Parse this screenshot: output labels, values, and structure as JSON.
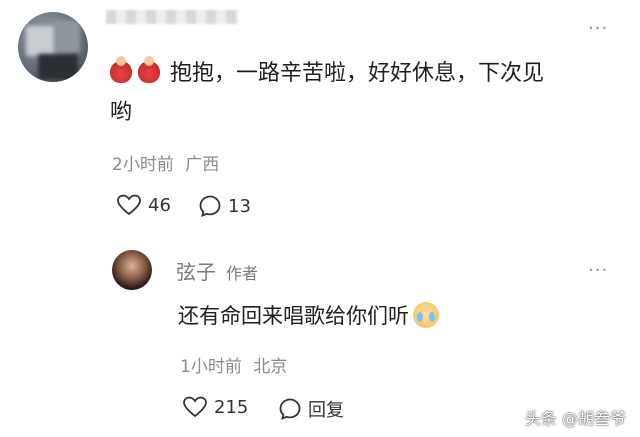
{
  "comment": {
    "text_line1": "抱抱，一路辛苦啦，好好休息，下次见",
    "text_line2": "哟",
    "time": "2小时前",
    "location": "广西",
    "likes": "46",
    "replies": "13",
    "more": "···",
    "emoji": "hug-emoji"
  },
  "reply": {
    "name": "弦子",
    "badge": "作者",
    "text": "还有命回来唱歌给你们听",
    "time": "1小时前",
    "location": "北京",
    "likes": "215",
    "reply_label": "回复",
    "more": "···",
    "emoji": "cry-emoji"
  },
  "watermark": "头条 @胡叁爷"
}
